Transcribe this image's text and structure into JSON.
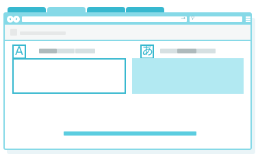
{
  "window": {
    "accent": "#37b8cf",
    "light": "#86d9e7",
    "fill": "#b2e9f2"
  },
  "tabs": [
    "",
    "",
    "",
    ""
  ],
  "toolbar": {
    "back_icon": "chevron-left-icon",
    "forward_icon": "chevron-right-icon",
    "go_icon": "arrow-right-icon",
    "search_icon": "search-icon",
    "menu_icon": "hamburger-menu-icon"
  },
  "source": {
    "glyph": "A"
  },
  "target": {
    "glyph": "あ"
  }
}
